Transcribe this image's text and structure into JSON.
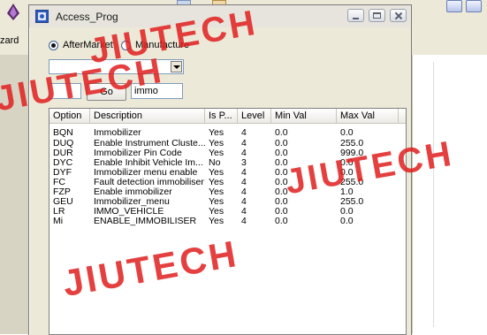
{
  "background": {
    "wizard_label": "zard"
  },
  "window": {
    "title": "Access_Prog"
  },
  "radio": {
    "aftermarket_label": "AfterMarket",
    "manufacture_label": "Manufacture",
    "selected": "AfterMarket"
  },
  "combo": {
    "value": ""
  },
  "search": {
    "code_value": "",
    "go_label": "Go",
    "query_value": "immo"
  },
  "table": {
    "headers": [
      "Option",
      "Description",
      "Is P...",
      "Level",
      "Min Val",
      "Max Val"
    ],
    "rows": [
      [
        "BQN",
        "Immobilizer",
        "Yes",
        "4",
        "0.0",
        "0.0"
      ],
      [
        "DUQ",
        "Enable Instrument Cluste...",
        "Yes",
        "4",
        "0.0",
        "255.0"
      ],
      [
        "DUR",
        "Immobilizer Pin Code",
        "Yes",
        "4",
        "0.0",
        "999.0"
      ],
      [
        "DYC",
        "Enable Inhibit Vehicle Im...",
        "No",
        "3",
        "0.0",
        "0.0"
      ],
      [
        "DYF",
        "Immobilizer menu enable",
        "Yes",
        "4",
        "0.0",
        "0.0"
      ],
      [
        "FC",
        "Fault detection immobiliser",
        "Yes",
        "4",
        "0.0",
        "255.0"
      ],
      [
        "FZP",
        "Enable immobilizer",
        "Yes",
        "4",
        "0.0",
        "1.0"
      ],
      [
        "GEU",
        "Immobilizer_menu",
        "Yes",
        "4",
        "0.0",
        "255.0"
      ],
      [
        "LR",
        "IMMO_VEHICLE",
        "Yes",
        "4",
        "0.0",
        "0.0"
      ],
      [
        "Mi",
        "ENABLE_IMMOBILISER",
        "Yes",
        "4",
        "0.0",
        "0.0"
      ]
    ]
  },
  "watermark": {
    "text": "JIUTECH"
  },
  "colors": {
    "dialog_bg": "#ece9d8",
    "watermark": "#e11e1e",
    "field_border": "#7f9db9"
  }
}
